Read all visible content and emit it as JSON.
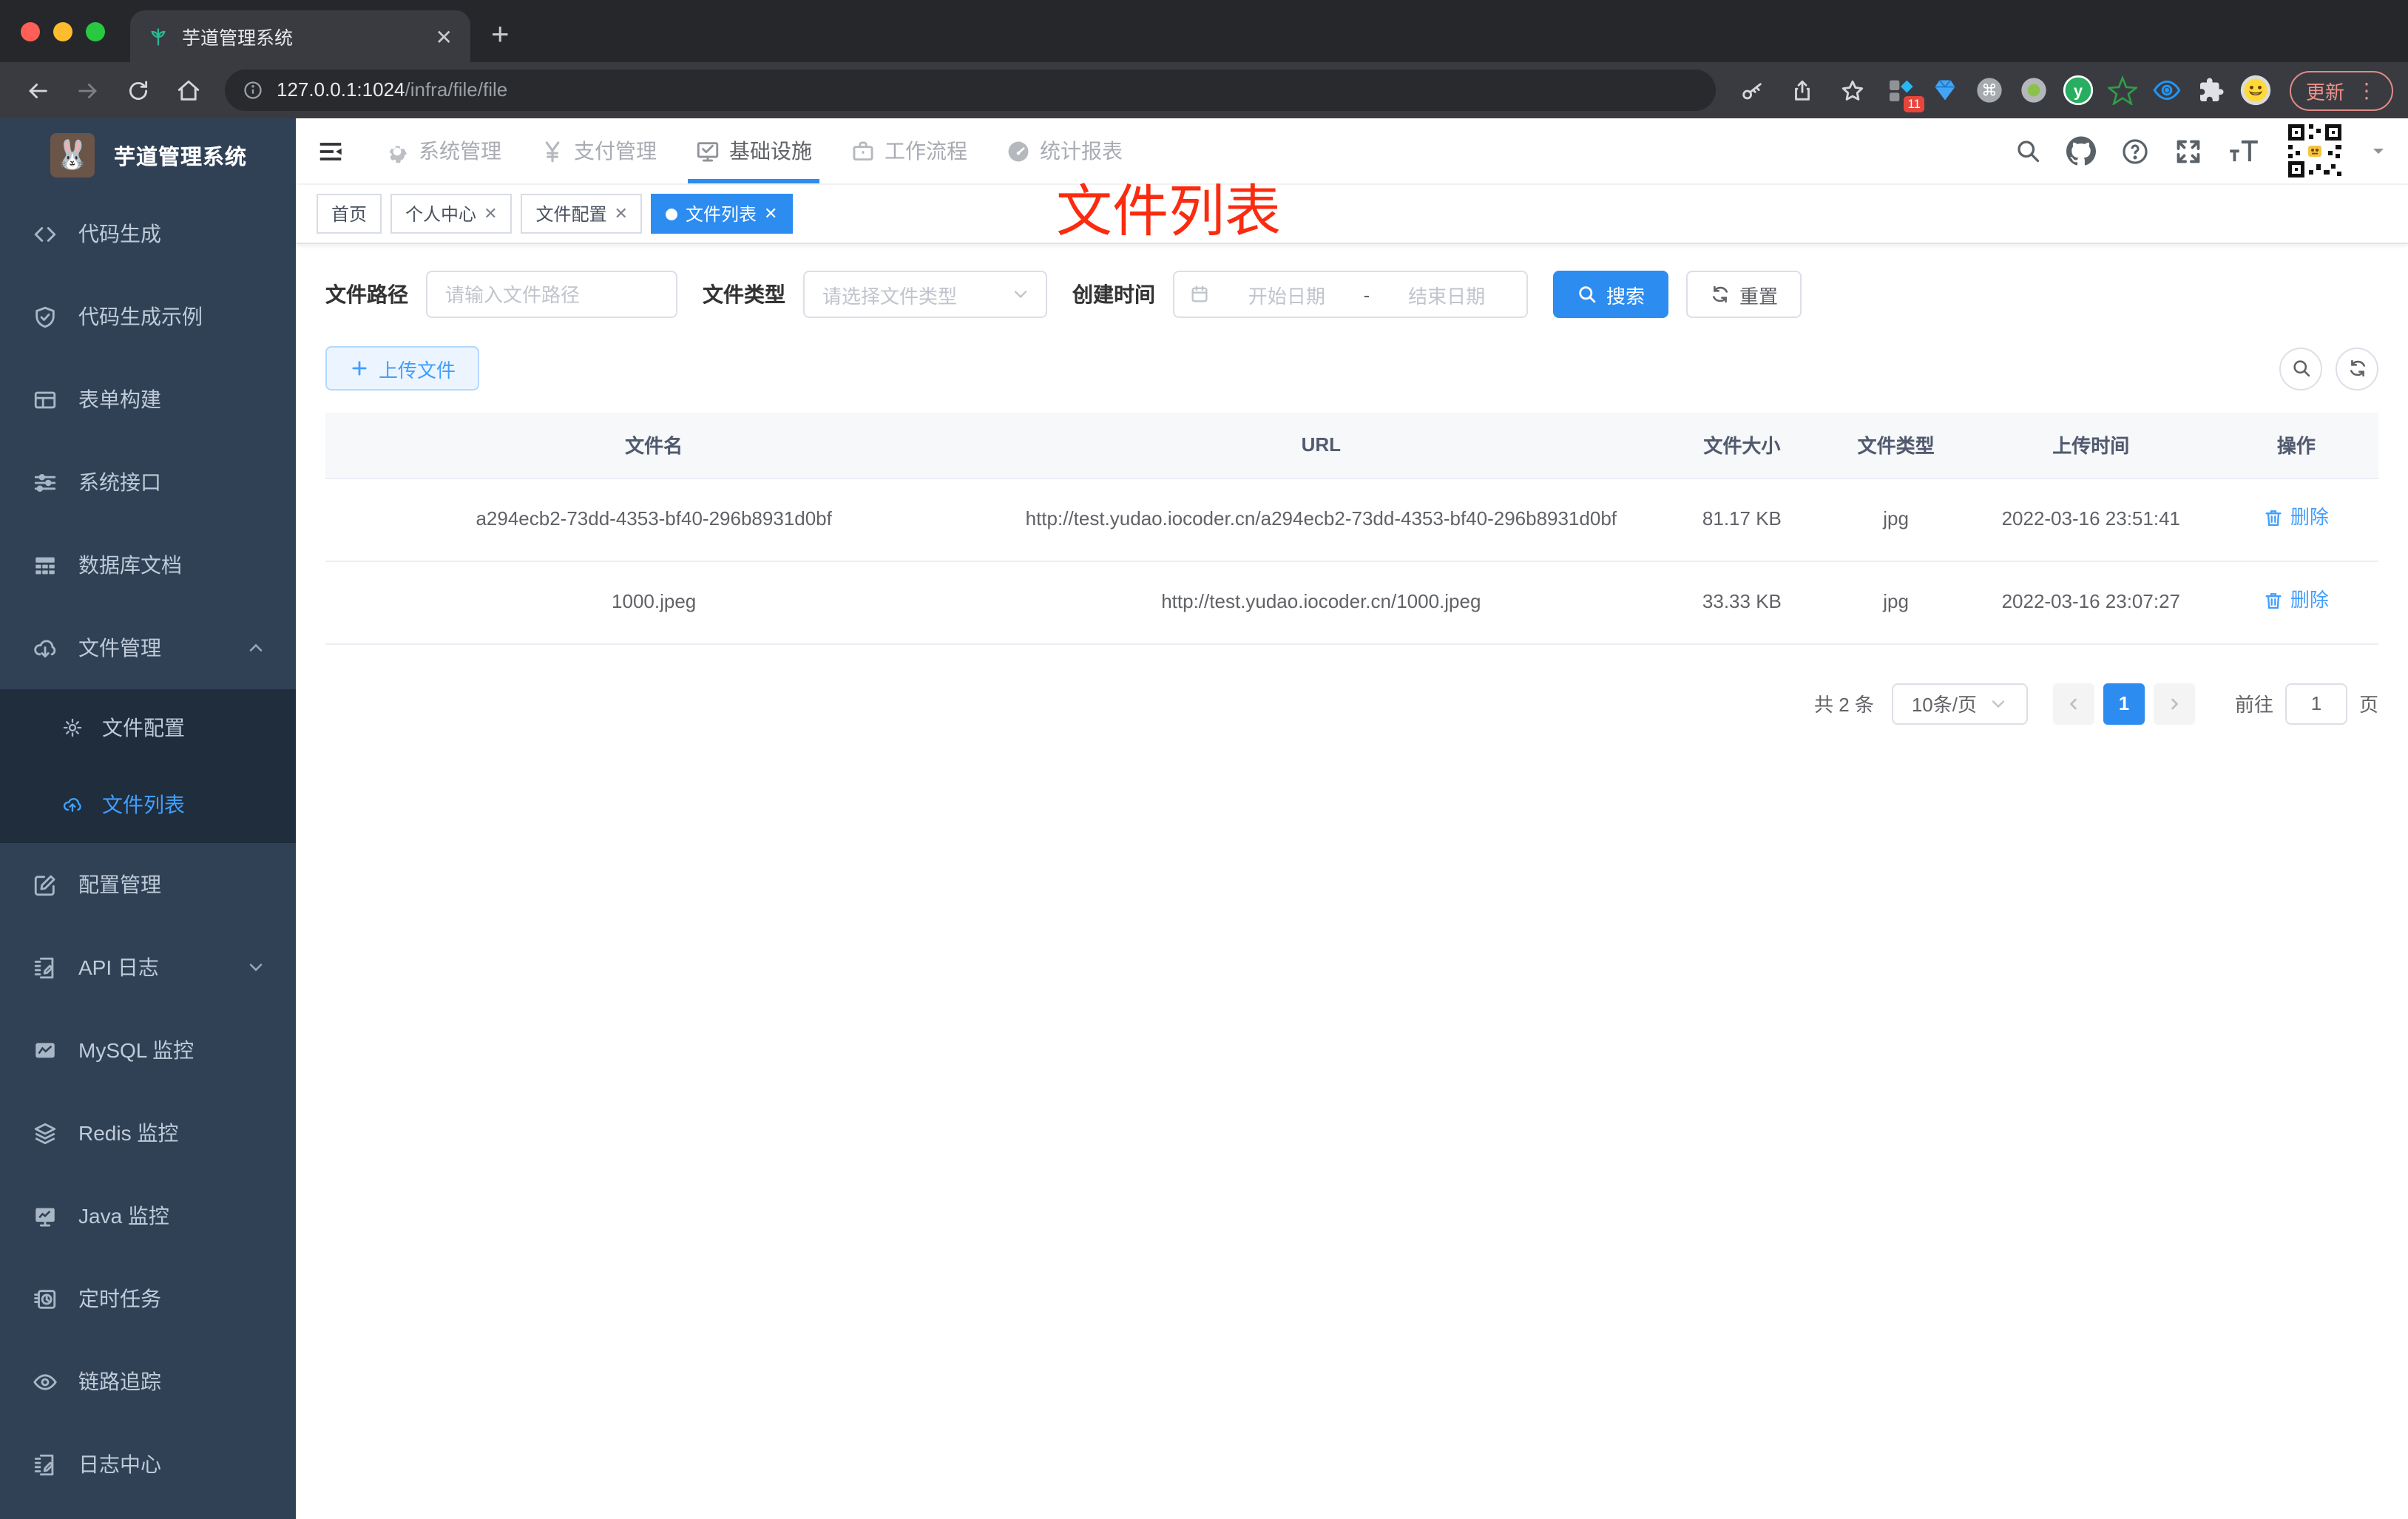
{
  "browser": {
    "tab_title": "芋道管理系统",
    "url_host": "127.0.0.1:1024",
    "url_path": "/infra/file/file",
    "extensions_badge": "11",
    "update_label": "更新",
    "menu_dots": "⋮"
  },
  "sidebar": {
    "title": "芋道管理系统",
    "items": [
      {
        "icon": "code-icon",
        "label": "代码生成"
      },
      {
        "icon": "shield-check-icon",
        "label": "代码生成示例"
      },
      {
        "icon": "form-table-icon",
        "label": "表单构建"
      },
      {
        "icon": "sliders-icon",
        "label": "系统接口"
      },
      {
        "icon": "database-grid-icon",
        "label": "数据库文档"
      },
      {
        "icon": "cloud-download-icon",
        "label": "文件管理",
        "expanded": true
      },
      {
        "icon": "edit-square-icon",
        "label": "配置管理"
      },
      {
        "icon": "document-edit-icon",
        "label": "API 日志",
        "collapsed": true
      },
      {
        "icon": "chart-monitor-icon",
        "label": "MySQL 监控"
      },
      {
        "icon": "layers-icon",
        "label": "Redis 监控"
      },
      {
        "icon": "monitor-icon",
        "label": "Java 监控"
      },
      {
        "icon": "schedule-icon",
        "label": "定时任务"
      },
      {
        "icon": "eye-icon",
        "label": "链路追踪"
      },
      {
        "icon": "log-edit-icon",
        "label": "日志中心"
      }
    ],
    "submenu": [
      {
        "icon": "gear-icon",
        "label": "文件配置",
        "active": false
      },
      {
        "icon": "cloud-upload-icon",
        "label": "文件列表",
        "active": true
      }
    ]
  },
  "topnav": {
    "items": [
      {
        "icon": "gear-icon",
        "label": "系统管理",
        "active": false
      },
      {
        "icon": "yen-icon",
        "label": "支付管理",
        "active": false
      },
      {
        "icon": "monitor-check-icon",
        "label": "基础设施",
        "active": true
      },
      {
        "icon": "briefcase-icon",
        "label": "工作流程",
        "active": false
      },
      {
        "icon": "dashboard-icon",
        "label": "统计报表",
        "active": false
      }
    ]
  },
  "tags": [
    {
      "label": "首页",
      "closable": false,
      "active": false
    },
    {
      "label": "个人中心",
      "closable": true,
      "active": false
    },
    {
      "label": "文件配置",
      "closable": true,
      "active": false
    },
    {
      "label": "文件列表",
      "closable": true,
      "active": true
    }
  ],
  "annotation": "文件列表",
  "filters": {
    "path_label": "文件路径",
    "path_placeholder": "请输入文件路径",
    "type_label": "文件类型",
    "type_placeholder": "请选择文件类型",
    "date_label": "创建时间",
    "date_start_placeholder": "开始日期",
    "date_separator": "-",
    "date_end_placeholder": "结束日期",
    "search_label": "搜索",
    "reset_label": "重置"
  },
  "actions": {
    "upload_label": "上传文件"
  },
  "table": {
    "headers": [
      "文件名",
      "URL",
      "文件大小",
      "文件类型",
      "上传时间",
      "操作"
    ],
    "rows": [
      {
        "name": "a294ecb2-73dd-4353-bf40-296b8931d0bf",
        "url": "http://test.yudao.iocoder.cn/a294ecb2-73dd-4353-bf40-296b8931d0bf",
        "size": "81.17 KB",
        "type": "jpg",
        "time": "2022-03-16 23:51:41",
        "action": "删除"
      },
      {
        "name": "1000.jpeg",
        "url": "http://test.yudao.iocoder.cn/1000.jpeg",
        "size": "33.33 KB",
        "type": "jpg",
        "time": "2022-03-16 23:07:27",
        "action": "删除"
      }
    ]
  },
  "pagination": {
    "total": "共 2 条",
    "page_size": "10条/页",
    "current": "1",
    "jump_prefix": "前往",
    "jump_value": "1",
    "jump_suffix": "页"
  },
  "colors": {
    "primary": "#2d8cf0",
    "link": "#409eff",
    "sidebar_bg": "#304156",
    "submenu_bg": "#1f2d3d",
    "annotation_red": "#fb2b10"
  }
}
